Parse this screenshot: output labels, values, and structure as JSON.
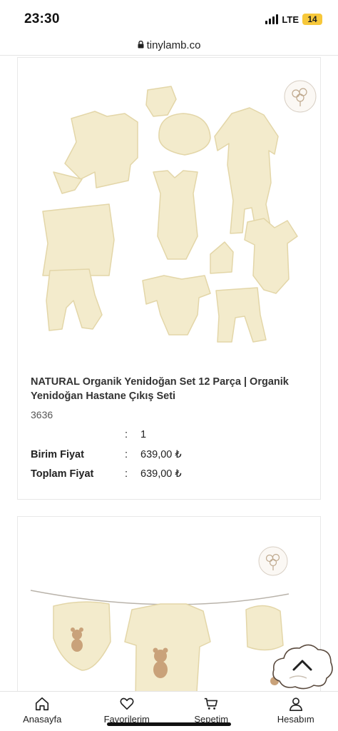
{
  "status_bar": {
    "time": "23:30",
    "network": "LTE",
    "battery": "14"
  },
  "browser": {
    "url": "tinylamb.co"
  },
  "product": {
    "title": "NATURAL Organik Yenidoğan Set 12 Parça | Organik Yenidoğan Hastane Çıkış Seti",
    "code": "3636",
    "quantity_label": "",
    "quantity_value": "1",
    "unit_price_label": "Birim Fiyat",
    "unit_price_value": "639,00 ₺",
    "total_price_label": "Toplam Fiyat",
    "total_price_value": "639,00 ₺",
    "colon": ":"
  },
  "bottom_nav": {
    "items": [
      {
        "label": "Anasayfa",
        "icon": "home-icon"
      },
      {
        "label": "Favorilerim",
        "icon": "heart-icon"
      },
      {
        "label": "Sepetim",
        "icon": "cart-icon"
      },
      {
        "label": "Hesabım",
        "icon": "user-icon"
      }
    ]
  },
  "colors": {
    "garment": "#f3ebcc",
    "garment_stroke": "#e3d6a8",
    "badge": "#d8cfc4",
    "bear": "#c9a27a"
  }
}
